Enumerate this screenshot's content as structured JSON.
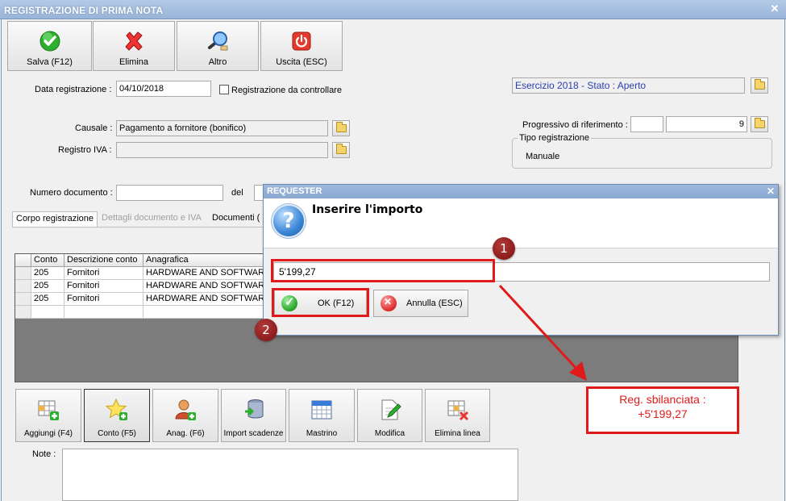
{
  "window": {
    "title": "REGISTRAZIONE DI PRIMA NOTA",
    "close": "✕"
  },
  "toolbar": [
    {
      "label": "Salva (F12)",
      "icon": "check-icon"
    },
    {
      "label": "Elimina",
      "icon": "delete-x-icon"
    },
    {
      "label": "Altro",
      "icon": "magnifier-icon"
    },
    {
      "label": "Uscita (ESC)",
      "icon": "power-icon"
    }
  ],
  "form": {
    "data_label": "Data registrazione :",
    "data_value": "04/10/2018",
    "controllare_label": "Registrazione da controllare",
    "esercizio_value": "Esercizio 2018 - Stato : Aperto",
    "causale_label": "Causale :",
    "causale_value": "Pagamento a fornitore (bonifico)",
    "registro_label": "Registro IVA :",
    "registro_value": "",
    "progressivo_label": "Progressivo di riferimento :",
    "progressivo_value": "9",
    "tipo_label": "Tipo registrazione",
    "tipo_value": "Manuale",
    "numdoc_label": "Numero documento :",
    "del_label": "del"
  },
  "tabs": [
    {
      "label": "Corpo registrazione",
      "state": "active"
    },
    {
      "label": "Dettagli documento e IVA",
      "state": "disabled"
    },
    {
      "label": "Documenti (",
      "state": "normal"
    }
  ],
  "grid": {
    "headers": [
      "",
      "Conto",
      "Descrizione conto",
      "Anagrafica"
    ],
    "rows": [
      [
        "",
        "205",
        "Fornitori",
        "HARDWARE AND SOFTWARE S"
      ],
      [
        "",
        "205",
        "Fornitori",
        "HARDWARE AND SOFTWARE S"
      ],
      [
        "",
        "205",
        "Fornitori",
        "HARDWARE AND SOFTWARE S"
      ],
      [
        "",
        "",
        "",
        ""
      ]
    ]
  },
  "bottom_buttons": [
    {
      "label": "Aggiungi (F4)",
      "icon": "grid-add-icon"
    },
    {
      "label": "Conto (F5)",
      "icon": "star-add-icon"
    },
    {
      "label": "Anag. (F6)",
      "icon": "user-add-icon"
    },
    {
      "label": "Import scadenze",
      "icon": "database-import-icon"
    },
    {
      "label": "Mastrino",
      "icon": "calendar-icon"
    },
    {
      "label": "Modifica",
      "icon": "edit-document-icon"
    },
    {
      "label": "Elimina linea",
      "icon": "grid-delete-icon"
    }
  ],
  "notes_label": "Note :",
  "dialog": {
    "title": "REQUESTER",
    "close": "✕",
    "message": "Inserire l'importo",
    "input_value": "5'199,27",
    "ok_label": "OK (F12)",
    "cancel_label": "Annulla (ESC)"
  },
  "annotations": {
    "marker1": "1",
    "marker2": "2",
    "callout_line1": "Reg. sbilanciata :",
    "callout_line2": "+5'199,27",
    "color": "#e01a1a"
  }
}
